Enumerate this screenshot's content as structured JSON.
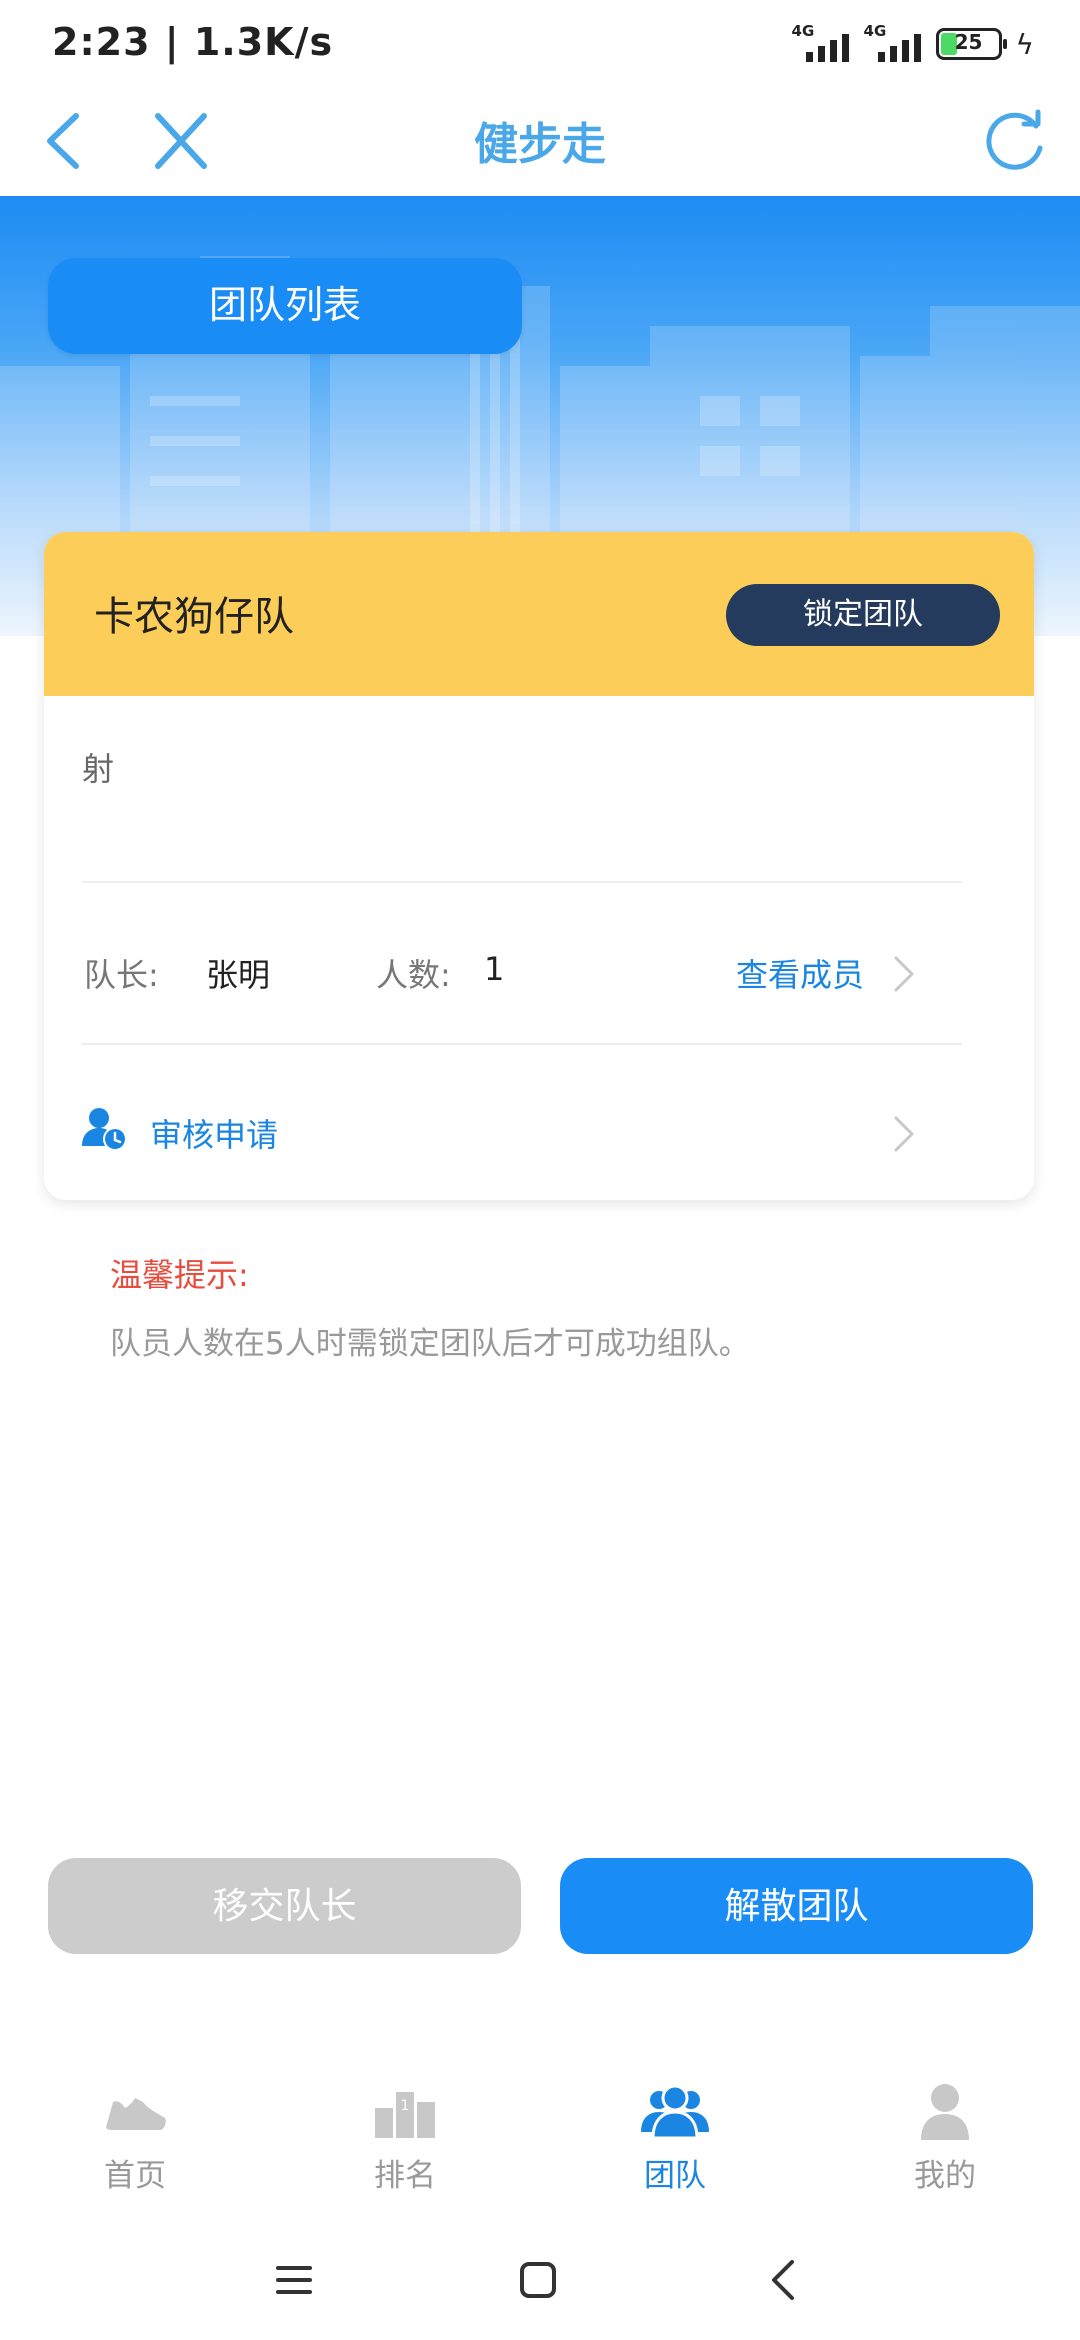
{
  "status_bar": {
    "time": "2:23 | 1.3K/s",
    "signal1_label": "4G",
    "signal2_label": "4G",
    "battery": "25"
  },
  "nav": {
    "title": "健步走"
  },
  "banner": {
    "team_list_label": "团队列表"
  },
  "team_card": {
    "name": "卡农狗仔队",
    "lock_label": "锁定团队",
    "slogan": "射",
    "leader_label": "队长:",
    "leader_value": "张明",
    "count_label": "人数:",
    "count_value": "1",
    "view_members_label": "查看成员",
    "review_label": "审核申请"
  },
  "tip": {
    "title": "温馨提示:",
    "text": "队员人数在5人时需锁定团队后才可成功组队。"
  },
  "actions": {
    "transfer_label": "移交队长",
    "dissolve_label": "解散团队"
  },
  "tabs": [
    {
      "label": "首页",
      "icon": "shoe-icon"
    },
    {
      "label": "排名",
      "icon": "podium-icon"
    },
    {
      "label": "团队",
      "icon": "team-icon"
    },
    {
      "label": "我的",
      "icon": "user-icon"
    }
  ],
  "active_tab": "团队",
  "colors": {
    "primary": "#1a8cf5",
    "header_yellow": "#fdcd5a",
    "lock_button": "#243b5e",
    "tip_red": "#e84c3d",
    "disabled": "#cccccc"
  }
}
